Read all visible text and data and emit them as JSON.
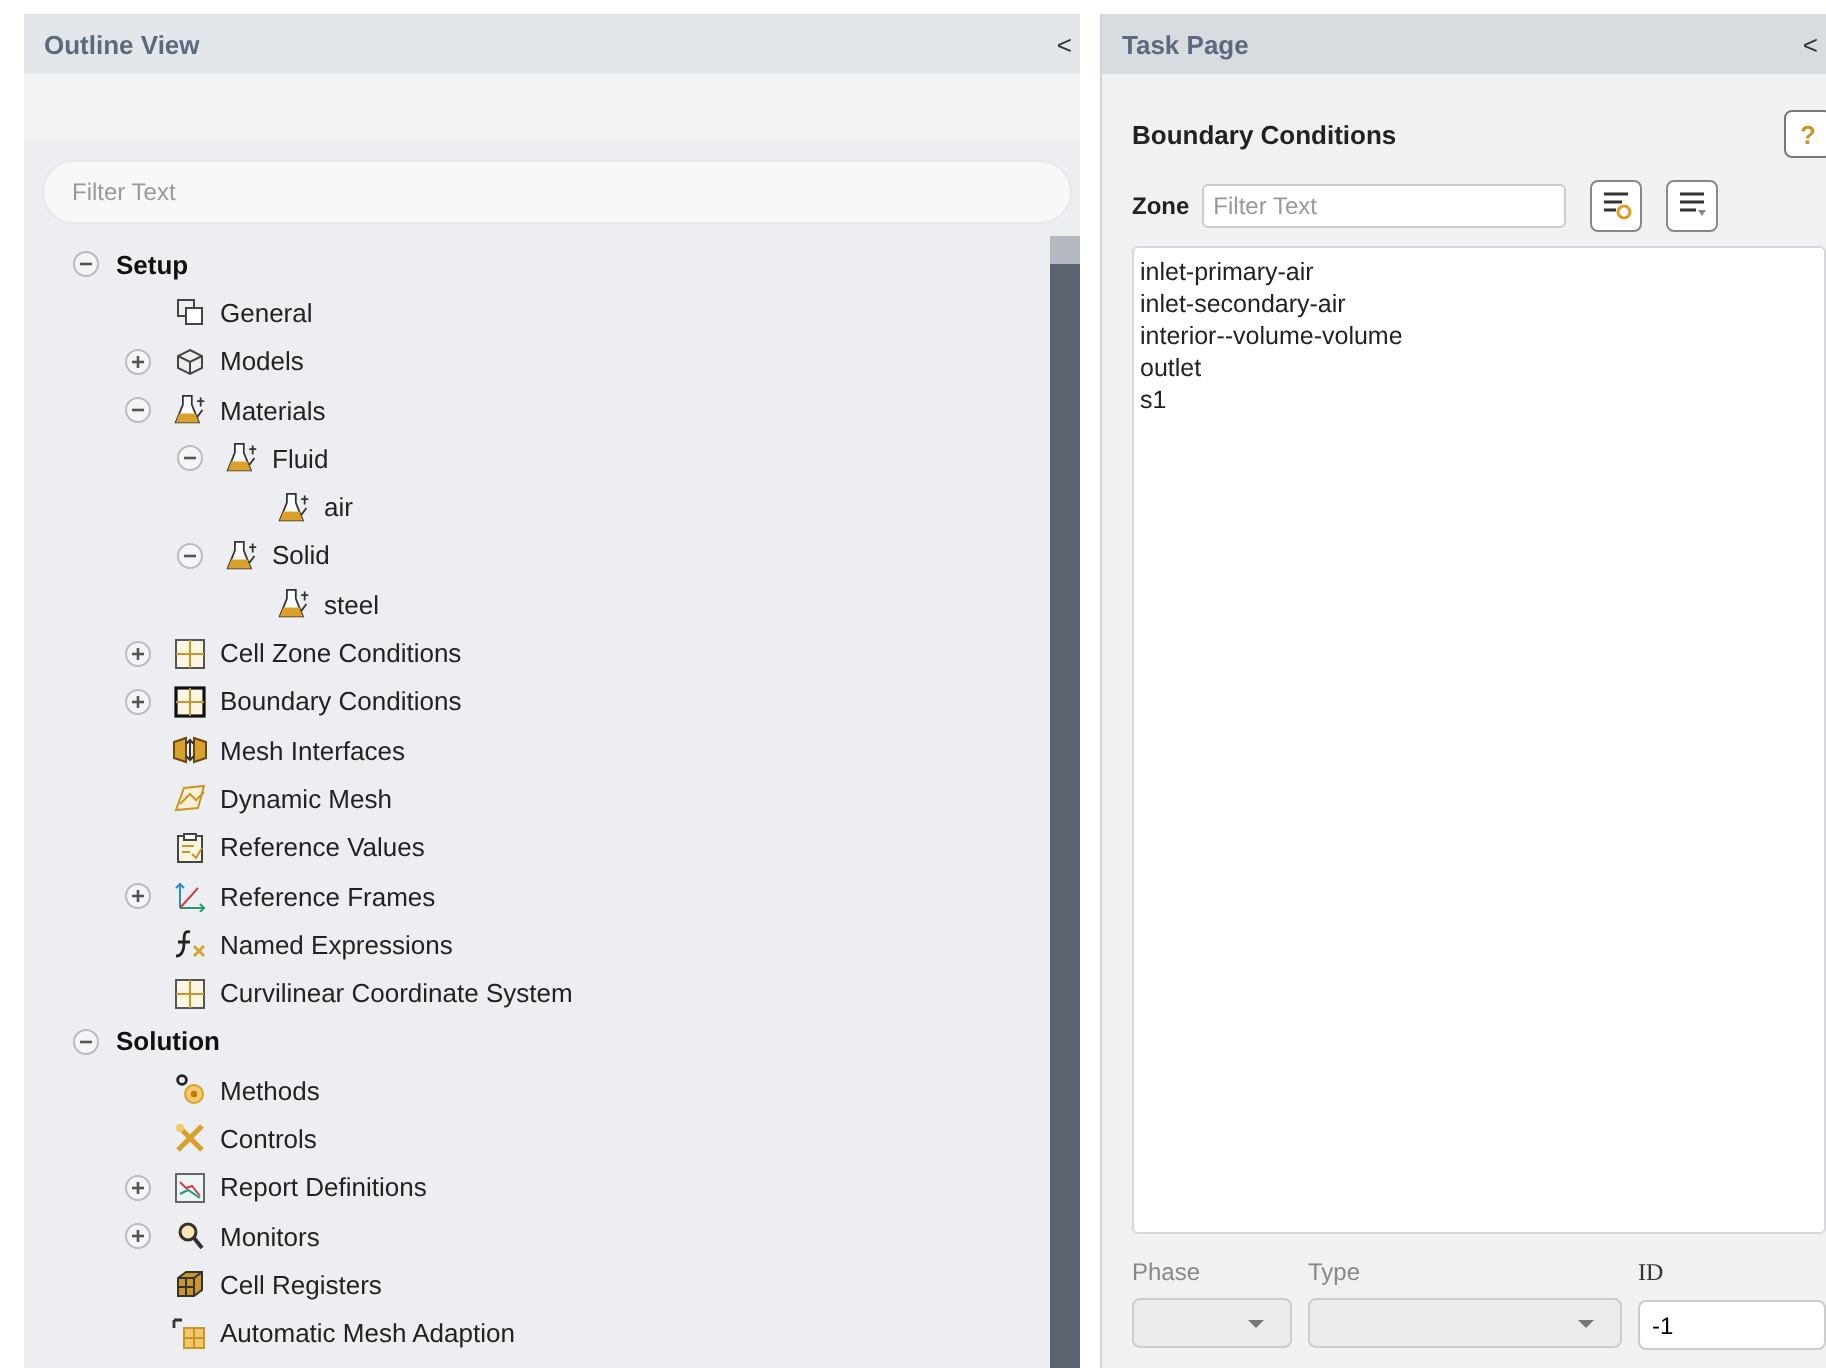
{
  "outline_panel": {
    "title": "Outline View",
    "collapse_glyph": "<",
    "filter": {
      "placeholder": "Filter Text"
    },
    "tree": [
      {
        "label": "Setup",
        "expanded": true,
        "children": [
          {
            "label": "General"
          },
          {
            "label": "Models",
            "expanded": false
          },
          {
            "label": "Materials",
            "expanded": true,
            "children": [
              {
                "label": "Fluid",
                "expanded": true,
                "children": [
                  {
                    "label": "air"
                  }
                ]
              },
              {
                "label": "Solid",
                "expanded": true,
                "children": [
                  {
                    "label": "steel"
                  }
                ]
              }
            ]
          },
          {
            "label": "Cell Zone Conditions",
            "expanded": false
          },
          {
            "label": "Boundary Conditions",
            "expanded": false
          },
          {
            "label": "Mesh Interfaces"
          },
          {
            "label": "Dynamic Mesh"
          },
          {
            "label": "Reference Values"
          },
          {
            "label": "Reference Frames",
            "expanded": false
          },
          {
            "label": "Named Expressions"
          },
          {
            "label": "Curvilinear Coordinate System"
          }
        ]
      },
      {
        "label": "Solution",
        "expanded": true,
        "children": [
          {
            "label": "Methods"
          },
          {
            "label": "Controls"
          },
          {
            "label": "Report Definitions",
            "expanded": false
          },
          {
            "label": "Monitors",
            "expanded": false
          },
          {
            "label": "Cell Registers"
          },
          {
            "label": "Automatic Mesh Adaption"
          }
        ]
      }
    ]
  },
  "task_panel": {
    "title": "Task Page",
    "collapse_glyph": "<",
    "heading": "Boundary Conditions",
    "help_glyph": "?",
    "zone": {
      "label": "Zone",
      "placeholder": "Filter Text"
    },
    "zones": [
      "inlet-primary-air",
      "inlet-secondary-air",
      "interior--volume-volume",
      "outlet",
      "s1"
    ],
    "phase": {
      "label": "Phase"
    },
    "type": {
      "label": "Type"
    },
    "id": {
      "label": "ID",
      "value": "-1"
    }
  }
}
